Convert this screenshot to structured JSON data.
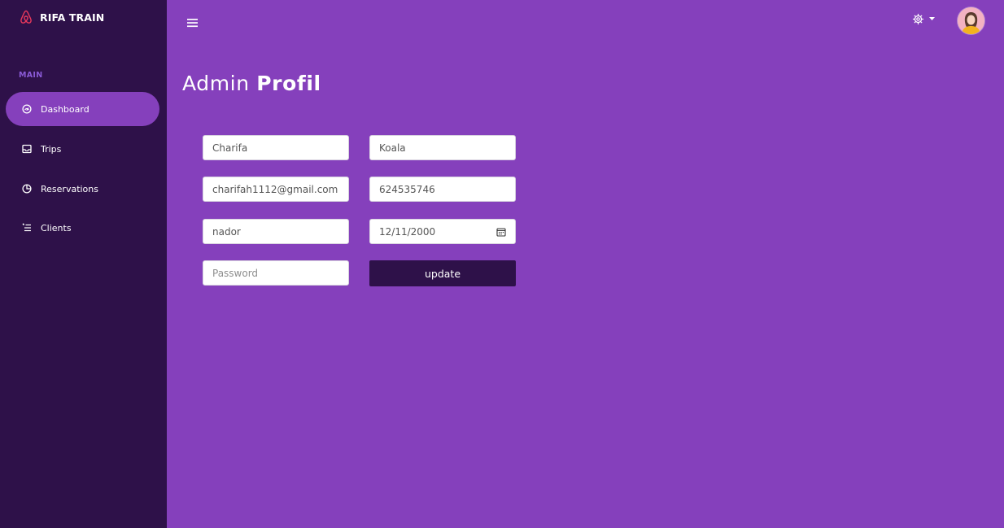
{
  "app": {
    "brand": "RIFA TRAIN",
    "brand_icon": "airbnb-logo-icon",
    "accent_color": "#8540bc",
    "sidebar_color": "#2e1149"
  },
  "sidebar": {
    "section_label": "MAIN",
    "items": [
      {
        "label": "Dashboard",
        "icon": "speedometer-icon",
        "active": true
      },
      {
        "label": "Trips",
        "icon": "inbox-icon",
        "active": false
      },
      {
        "label": "Reservations",
        "icon": "pie-chart-icon",
        "active": false
      },
      {
        "label": "Clients",
        "icon": "list-icon",
        "active": false
      }
    ]
  },
  "topbar": {
    "menu_icon": "hamburger-icon",
    "settings_icon": "gear-icon",
    "dropdown_icon": "caret-down-icon",
    "avatar_icon": "user-avatar"
  },
  "page": {
    "title_prefix": "Admin",
    "title_strong": "Profil"
  },
  "form": {
    "first_name": {
      "value": "Charifa",
      "placeholder": ""
    },
    "last_name": {
      "value": "Koala",
      "placeholder": ""
    },
    "email": {
      "value": "charifah1112@gmail.com",
      "placeholder": ""
    },
    "phone": {
      "value": "624535746",
      "placeholder": ""
    },
    "city": {
      "value": "nador",
      "placeholder": ""
    },
    "birthdate": {
      "value": "12/11/2000",
      "placeholder": "",
      "icon": "calendar-icon"
    },
    "password": {
      "value": "",
      "placeholder": "Password"
    },
    "update_label": "update"
  }
}
